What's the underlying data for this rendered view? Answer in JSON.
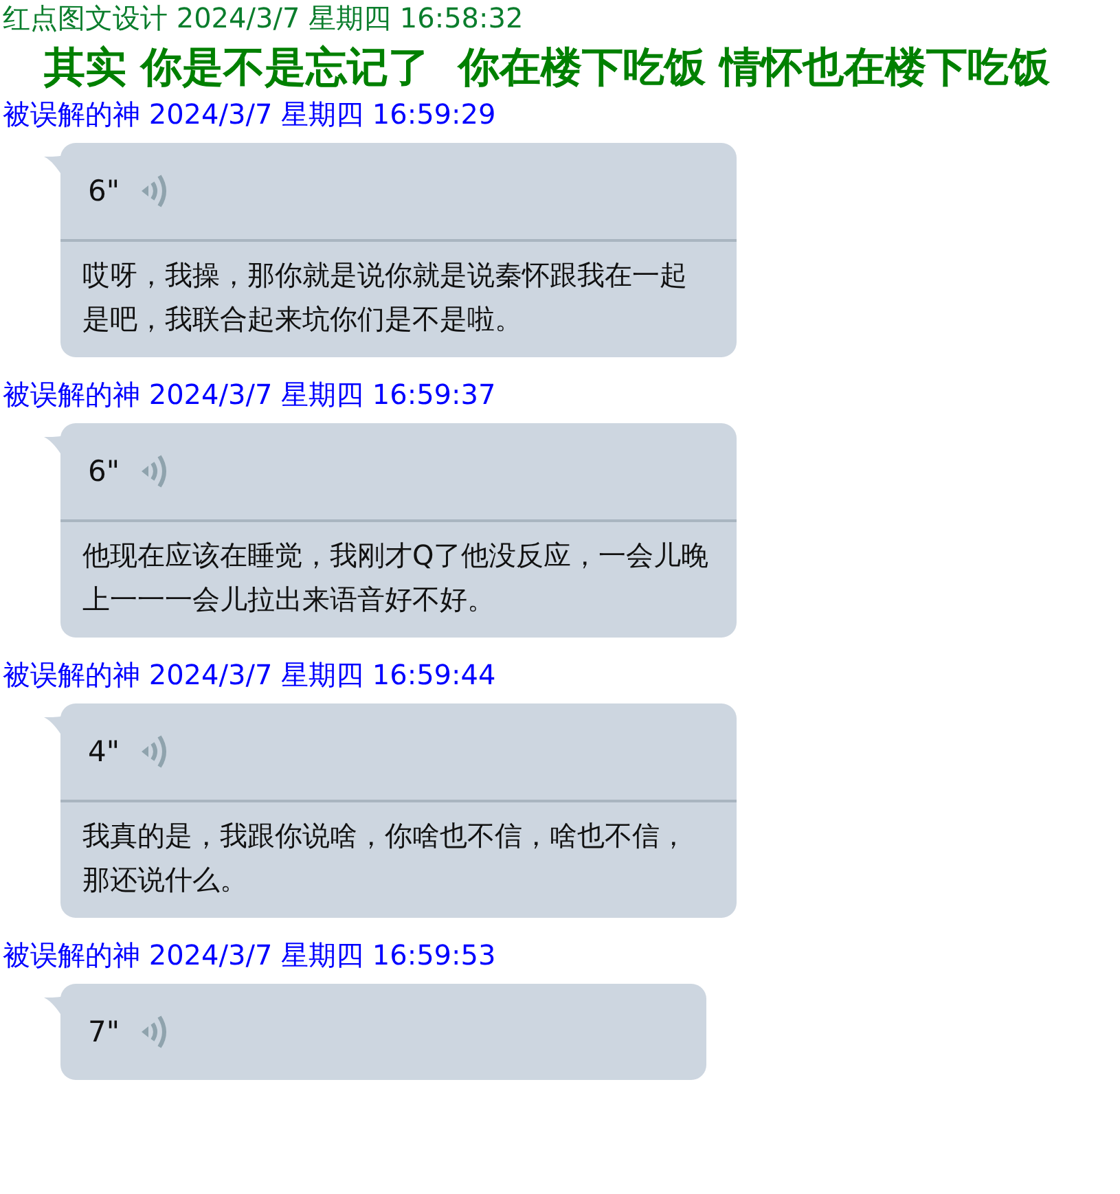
{
  "posts": [
    {
      "kind": "announcement",
      "sender": "红点图文设计",
      "timestamp": "2024/3/7 星期四 16:58:32",
      "text": "其实 你是不是忘记了  你在楼下吃饭 情怀也在楼下吃饭"
    },
    {
      "kind": "voice",
      "sender": "被误解的神",
      "timestamp": "2024/3/7 星期四 16:59:29",
      "duration": "6\"",
      "transcript": "哎呀，我操，那你就是说你就是说秦怀跟我在一起是吧，我联合起来坑你们是不是啦。"
    },
    {
      "kind": "voice",
      "sender": "被误解的神",
      "timestamp": "2024/3/7 星期四 16:59:37",
      "duration": "6\"",
      "transcript": "他现在应该在睡觉，我刚才Q了他没反应，一会儿晚上一一一会儿拉出来语音好不好。"
    },
    {
      "kind": "voice",
      "sender": "被误解的神",
      "timestamp": "2024/3/7 星期四 16:59:44",
      "duration": "4\"",
      "transcript": "我真的是，我跟你说啥，你啥也不信，啥也不信，那还说什么。"
    },
    {
      "kind": "voice",
      "sender": "被误解的神",
      "timestamp": "2024/3/7 星期四 16:59:53",
      "duration": "7\""
    }
  ]
}
